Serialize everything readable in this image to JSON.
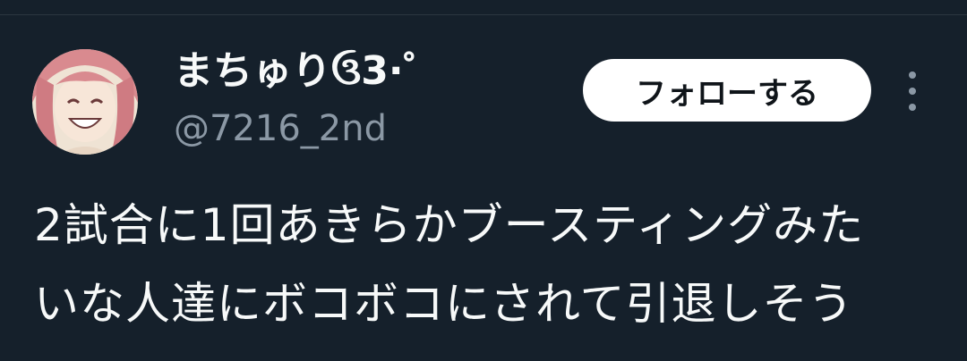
{
  "header": {
    "display_name": "まちゅりઉ3·゜",
    "handle": "@7216_2nd",
    "follow_label": "フォローする",
    "more_icon": "more-vertical-icon"
  },
  "tweet": {
    "lines": [
      "2試合に1回あきらかブースティングみた",
      "いな人達にボコボコにされて引退しそう"
    ]
  },
  "colors": {
    "background": "#15202b",
    "text_primary": "#f7f9f9",
    "text_secondary": "#8b98a5",
    "button_bg": "#ffffff",
    "button_text": "#0f1419"
  }
}
